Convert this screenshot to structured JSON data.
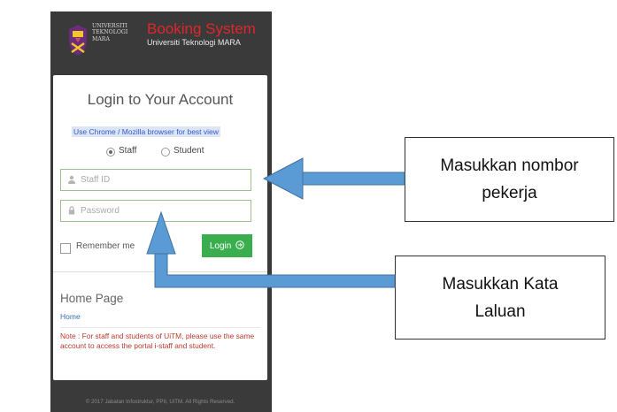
{
  "logo": {
    "university_lines": [
      "UNIVERSITI",
      "TEKNOLOGI",
      "MARA"
    ],
    "system_name": "Booking System",
    "system_subtitle": "Universiti Teknologi MARA"
  },
  "login": {
    "title": "Login to Your Account",
    "browser_notice": "Use Chrome / Mozilla browser for best view",
    "role_options": [
      {
        "label": "Staff",
        "selected": true
      },
      {
        "label": "Student",
        "selected": false
      }
    ],
    "staff_id_placeholder": "Staff ID",
    "password_placeholder": "Password",
    "remember_label": "Remember me",
    "login_button": "Login"
  },
  "home": {
    "title": "Home Page",
    "link": "Home"
  },
  "note": "Note : For staff and students of UiTM, please use the same account to access the portal i-staff and student.",
  "footer": "© 2017 Jabatan Infostruktur, PPII, UiTM. All Rights Reserved.",
  "callouts": {
    "staff_id": [
      "Masukkan nombor",
      "pekerja"
    ],
    "password": [
      "Masukkan Kata",
      "Laluan"
    ]
  },
  "colors": {
    "frame": "#3a3a3a",
    "brand_red": "#e0262d",
    "login_green": "#3aad4f",
    "notice_bg": "#dbe5f6",
    "arrow_blue": "#5b9bd5"
  },
  "icons": [
    "crest-logo-icon",
    "user-icon",
    "lock-icon",
    "arrow-circle-right-icon"
  ]
}
